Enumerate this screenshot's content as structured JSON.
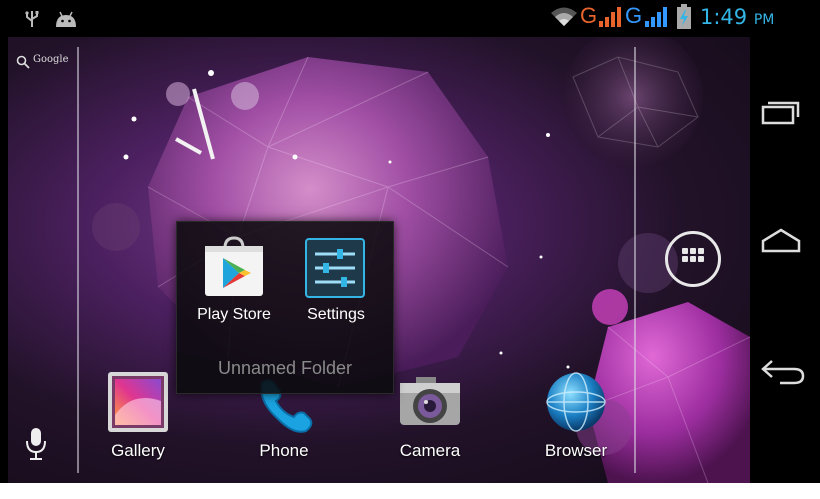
{
  "status_bar": {
    "left_icons": [
      "usb-icon",
      "android-debug-icon"
    ],
    "network_label_1": "G",
    "network_label_2": "G",
    "time": "1:49",
    "ampm": "PM",
    "colors": {
      "time": "#33b5e5",
      "wifi": "#aaaaaa",
      "carrier1": "#e8642c",
      "carrier2": "#3399ff"
    }
  },
  "search": {
    "label": "Google"
  },
  "folder": {
    "name": "Unnamed Folder",
    "items": [
      {
        "label": "Play Store",
        "icon": "play-store-icon"
      },
      {
        "label": "Settings",
        "icon": "settings-icon"
      }
    ]
  },
  "dock": [
    {
      "label": "Gallery",
      "icon": "gallery-icon"
    },
    {
      "label": "Phone",
      "icon": "phone-icon"
    },
    {
      "label": "Camera",
      "icon": "camera-icon"
    },
    {
      "label": "Browser",
      "icon": "browser-icon"
    }
  ],
  "nav": {
    "buttons": [
      "recent-apps-icon",
      "home-icon",
      "back-icon"
    ]
  },
  "all_apps": {
    "icon": "all-apps-icon"
  },
  "voice_search": {
    "icon": "microphone-icon"
  }
}
